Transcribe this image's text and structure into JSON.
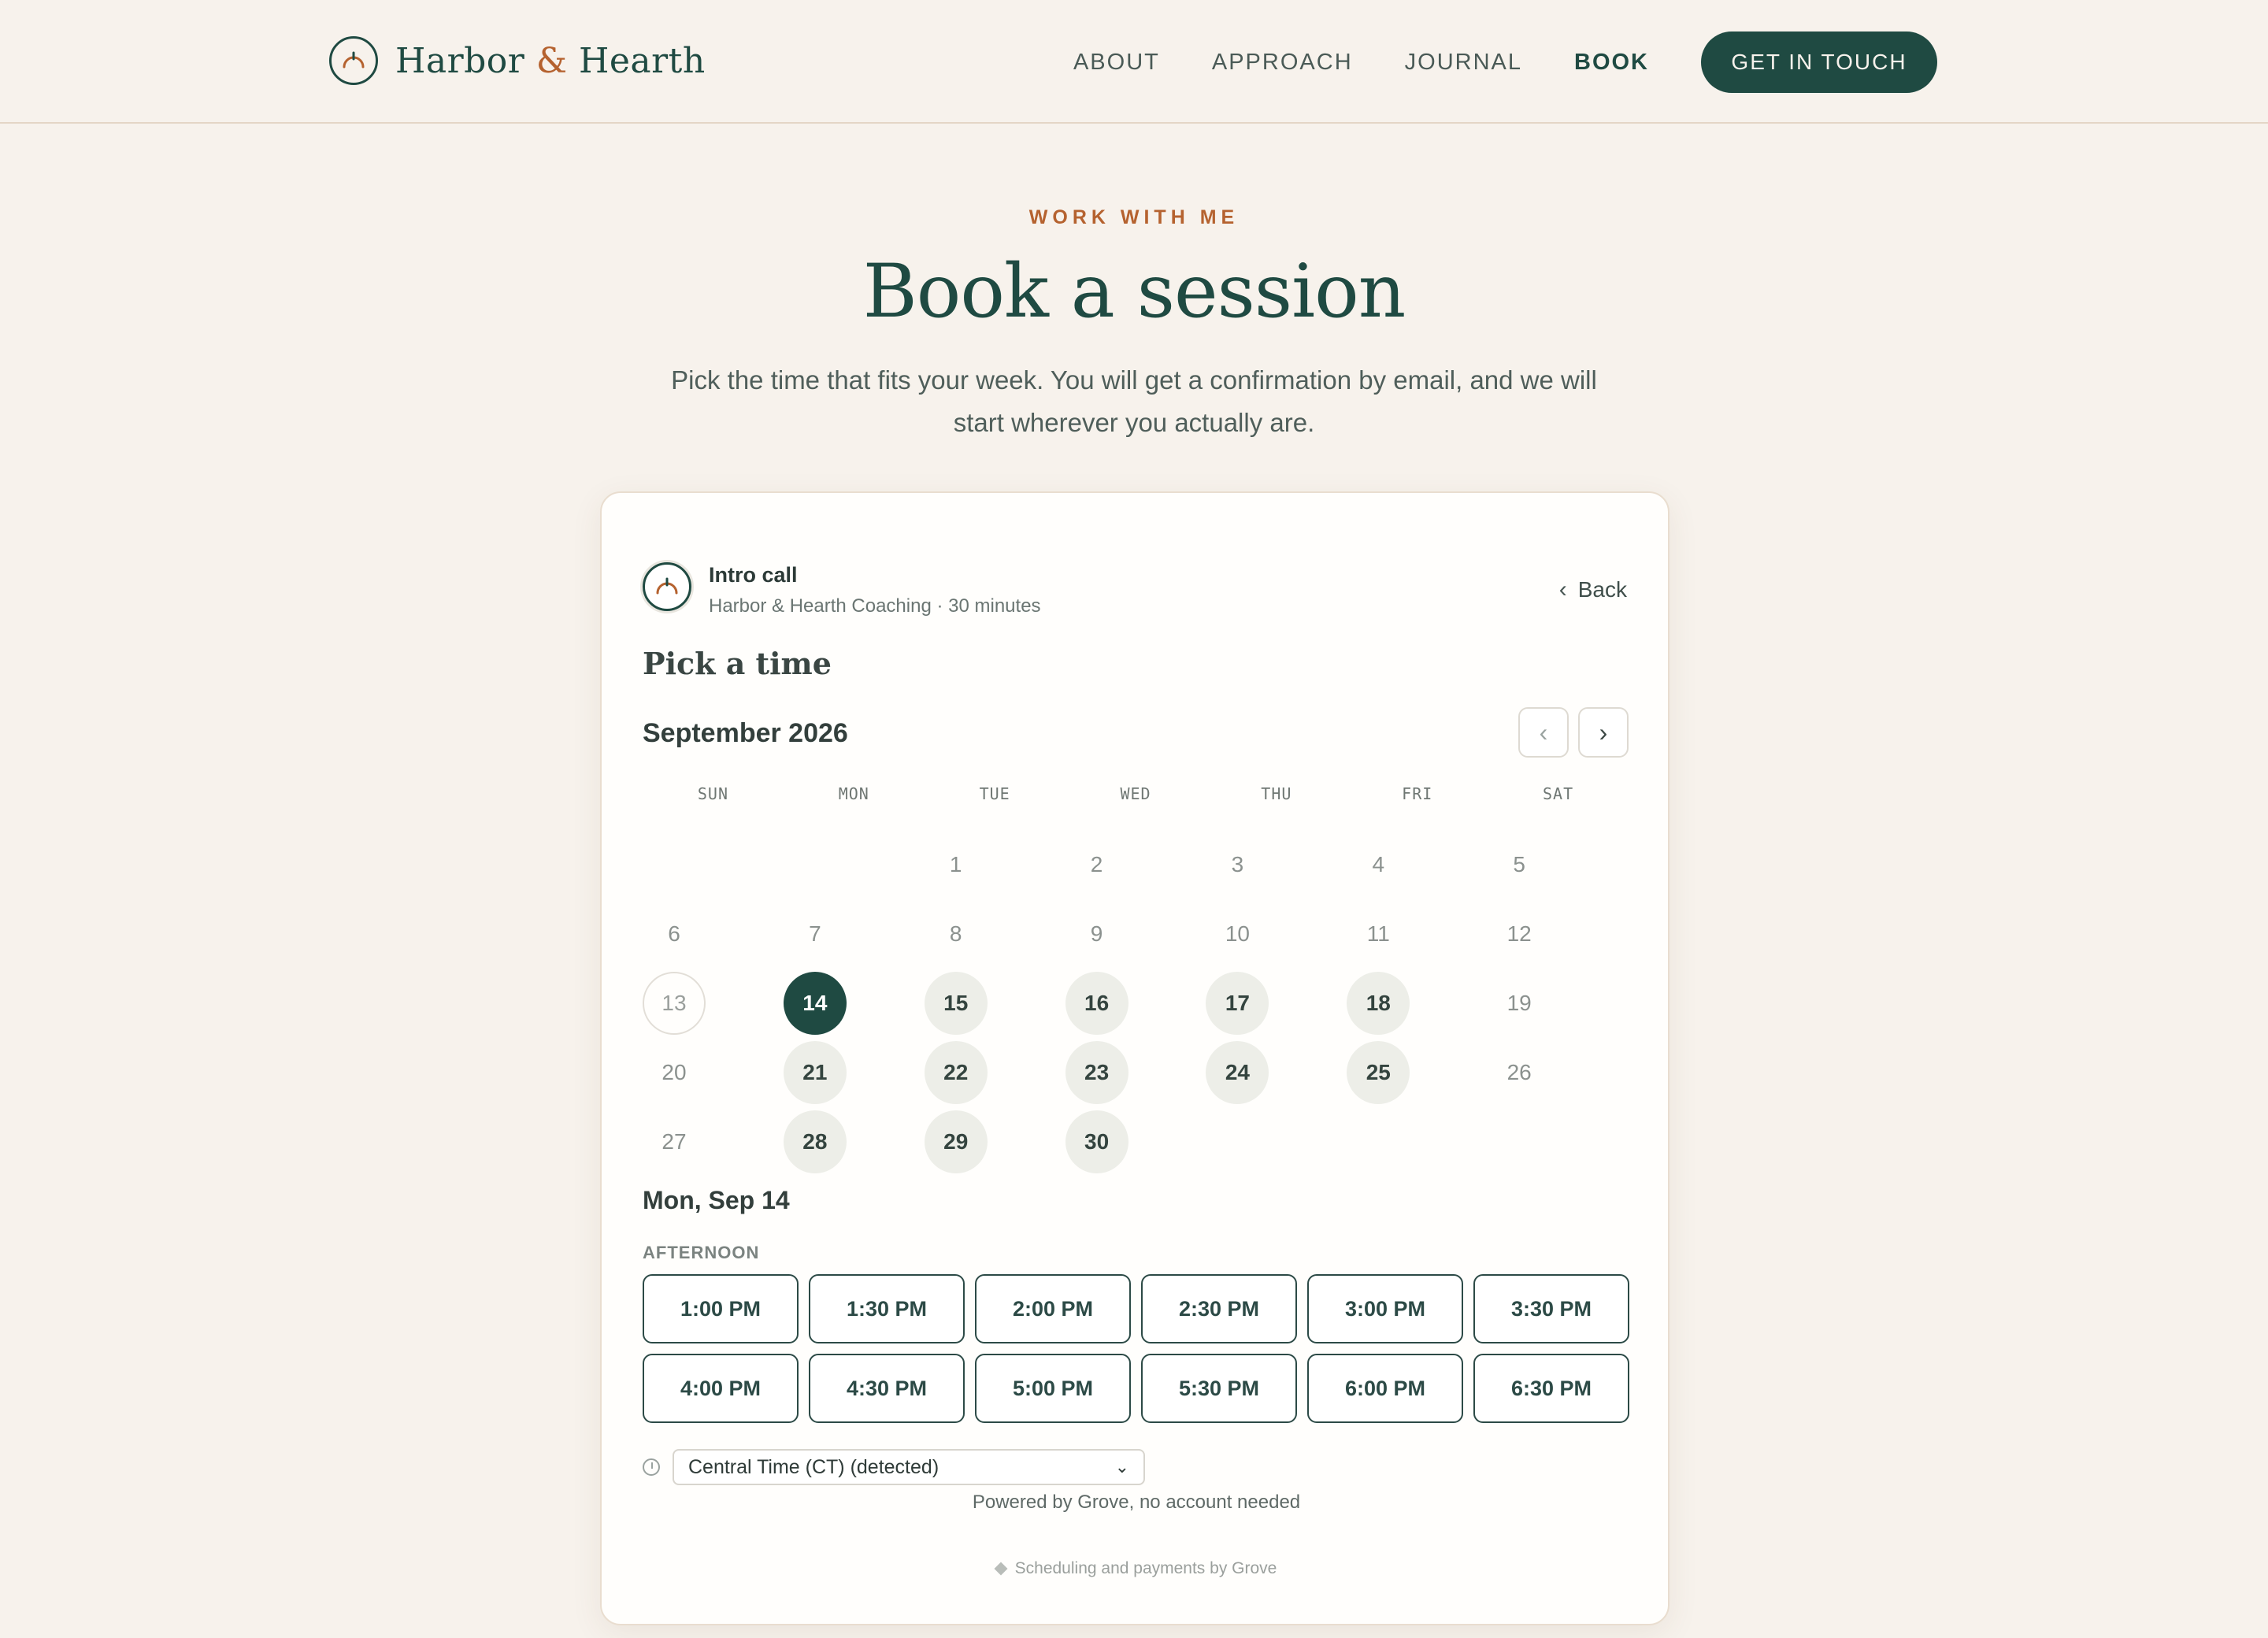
{
  "colors": {
    "primary": "#1f4a42",
    "accent": "#b5622f",
    "background": "#f7f2ec",
    "available_day": "#edeee8"
  },
  "brand": {
    "name_first": "Harbor",
    "ampersand": "&",
    "name_second": "Hearth",
    "logo_icon": "harbor-arc-icon"
  },
  "nav": {
    "links": [
      "ABOUT",
      "APPROACH",
      "JOURNAL",
      "BOOK"
    ],
    "active": "BOOK",
    "cta": "GET IN TOUCH"
  },
  "hero": {
    "eyebrow": "WORK WITH ME",
    "title": "Book a session",
    "intro": "Pick the time that fits your week. You will get a confirmation by email, and we will start wherever you actually are."
  },
  "booking": {
    "event_title": "Intro call",
    "event_subtitle": "Harbor & Hearth Coaching · 30 minutes",
    "back_label": "Back",
    "section_title": "Pick a time",
    "month_label": "September 2026",
    "weekdays": [
      "SUN",
      "MON",
      "TUE",
      "WED",
      "THU",
      "FRI",
      "SAT"
    ],
    "weeks": [
      [
        null,
        null,
        1,
        2,
        3,
        4,
        5
      ],
      [
        6,
        7,
        8,
        9,
        10,
        11,
        12
      ],
      [
        13,
        14,
        15,
        16,
        17,
        18,
        19
      ],
      [
        20,
        21,
        22,
        23,
        24,
        25,
        26
      ],
      [
        27,
        28,
        29,
        30,
        null,
        null,
        null
      ]
    ],
    "today": 13,
    "selected_day": 14,
    "available_days": [
      14,
      15,
      16,
      17,
      18,
      21,
      22,
      23,
      24,
      25,
      28,
      29,
      30
    ],
    "selected_date_label": "Mon, Sep 14",
    "period_label": "AFTERNOON",
    "slots": [
      "1:00 PM",
      "1:30 PM",
      "2:00 PM",
      "2:30 PM",
      "3:00 PM",
      "3:30 PM",
      "4:00 PM",
      "4:30 PM",
      "5:00 PM",
      "5:30 PM",
      "6:00 PM",
      "6:30 PM"
    ],
    "timezone": "Central Time (CT) (detected)",
    "powered_by": "Powered by Grove, no account needed",
    "footer_note": "Scheduling and payments by Grove"
  }
}
